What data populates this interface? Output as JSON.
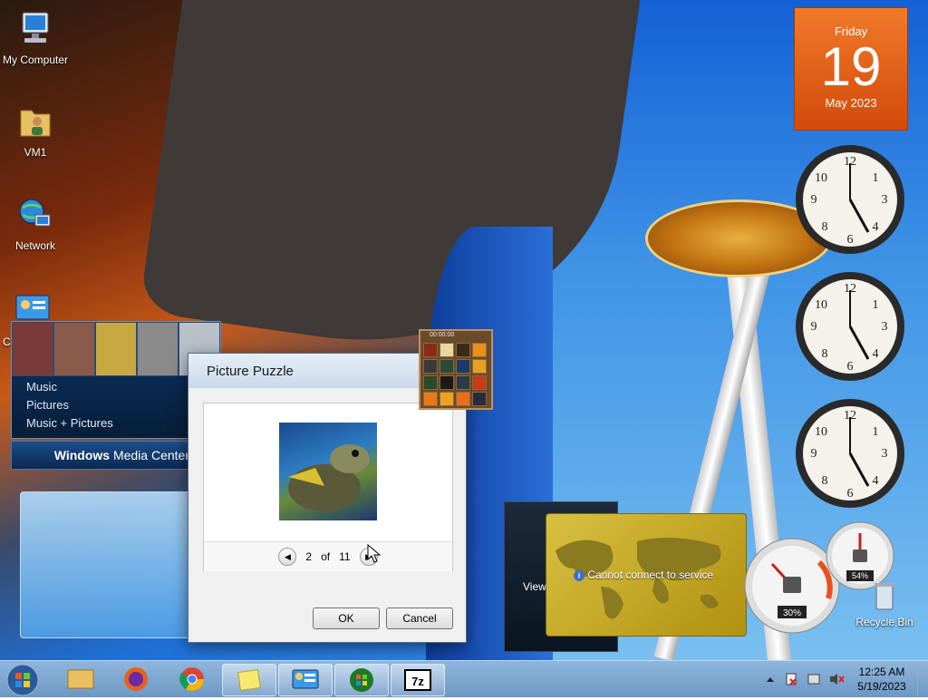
{
  "desktop_icons": [
    {
      "label": "My Computer",
      "icon": "computer-icon"
    },
    {
      "label": "VM1",
      "icon": "user-folder-icon"
    },
    {
      "label": "Network",
      "icon": "network-icon"
    },
    {
      "label": "C",
      "icon": "control-panel-icon"
    }
  ],
  "media_center": {
    "menu_items": [
      "Music",
      "Pictures",
      "Music + Pictures"
    ],
    "brand_bold": "Windows",
    "brand_rest": " Media Center"
  },
  "dialog": {
    "title": "Picture Puzzle",
    "page_current": "2",
    "page_of": "of",
    "page_total": "11",
    "ok_label": "OK",
    "cancel_label": "Cancel"
  },
  "puzzle_gadget": {
    "timer": "00:00:00"
  },
  "calendar": {
    "day_name": "Friday",
    "day_number": "19",
    "month_year": "May 2023"
  },
  "weather": {
    "message": "Cannot connect to service"
  },
  "side_panel": {
    "label": "View"
  },
  "meters": {
    "cpu_percent": "30%",
    "memory_percent": "54%"
  },
  "recycle_bin": {
    "label": "Recycle Bin"
  },
  "taskbar": {
    "items": [
      "file-explorer-icon",
      "firefox-icon",
      "chrome-icon",
      "sticky-notes-icon",
      "gadgets-icon",
      "windows-media-center-icon",
      "7zip-icon"
    ],
    "clock_time": "12:25 AM",
    "clock_date": "5/19/2023"
  },
  "colors": {
    "calendar_orange": "#e8661a",
    "taskbar_blue": "#7ea8d2"
  }
}
